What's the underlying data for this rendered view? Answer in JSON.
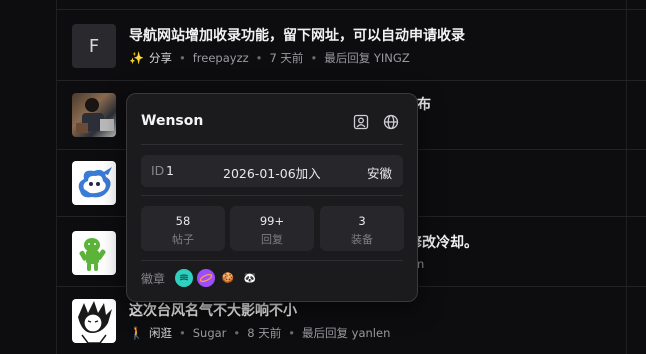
{
  "topics": [
    {
      "title": "导航网站增加收录功能，留下网址，可以自动申请收录",
      "avatar_letter": "F",
      "emoji": "✨",
      "category": "分享",
      "author": "freepayzz",
      "time": "7 天前",
      "last_reply": "最后回复 YINGZ"
    },
    {
      "title": "布"
    },
    {},
    {
      "title": "修改冷却。",
      "meta_tail": "n"
    },
    {
      "title": "这次台风名气不大影响不小",
      "emoji": "🚶",
      "category": "闲逛",
      "author": "Sugar",
      "time": "8 天前",
      "last_reply": "最后回复 yanlen"
    }
  ],
  "meta_separator": "•",
  "profile_card": {
    "name": "Wenson",
    "id_label": "ID",
    "id": "1",
    "joined": "2026-01-06加入",
    "location": "安徽",
    "stats": [
      {
        "value": "58",
        "label": "帖子"
      },
      {
        "value": "99+",
        "label": "回复"
      },
      {
        "value": "3",
        "label": "装备"
      }
    ],
    "badges_label": "徽章",
    "badges": [
      {
        "name": "wind-badge",
        "color": "#2fd0c0"
      },
      {
        "name": "orbit-badge",
        "color": "#9b4dff"
      },
      {
        "name": "cookie-badge",
        "color": "#c98a4b",
        "emoji": "🍪"
      },
      {
        "name": "panda-badge",
        "color": "#ffffff",
        "emoji": "🐼"
      }
    ]
  }
}
